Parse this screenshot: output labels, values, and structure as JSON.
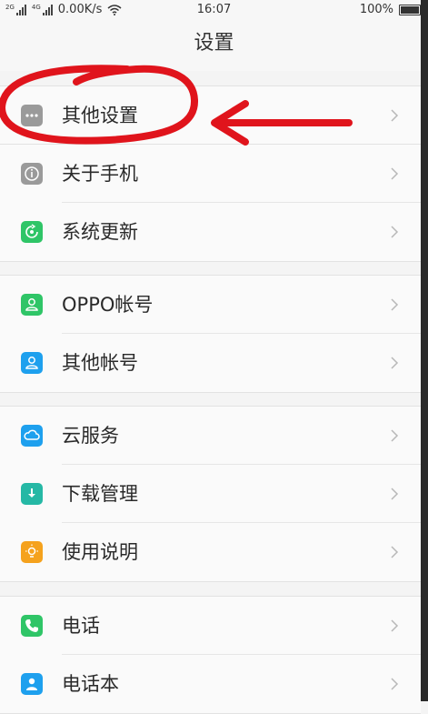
{
  "status_bar": {
    "sim1_tag": "2G",
    "sim2_tag": "4G",
    "network_speed": "0.00K/s",
    "time": "16:07",
    "battery": "100%"
  },
  "header": {
    "title": "设置"
  },
  "groups": [
    [
      {
        "label": "其他设置",
        "icon": "more-dots-icon",
        "color": "#9a9a9a"
      }
    ],
    [
      {
        "label": "关于手机",
        "icon": "info-icon",
        "color": "#9a9a9a"
      },
      {
        "label": "系统更新",
        "icon": "update-icon",
        "color": "#2fc567"
      }
    ],
    [
      {
        "label": "OPPO帐号",
        "icon": "person-icon",
        "color": "#2fc567"
      },
      {
        "label": "其他帐号",
        "icon": "person-icon",
        "color": "#1ea0ee"
      }
    ],
    [
      {
        "label": "云服务",
        "icon": "cloud-icon",
        "color": "#1ea0ee"
      },
      {
        "label": "下载管理",
        "icon": "download-icon",
        "color": "#25b8a5"
      },
      {
        "label": "使用说明",
        "icon": "bulb-icon",
        "color": "#f5a21d"
      }
    ],
    [
      {
        "label": "电话",
        "icon": "phone-icon",
        "color": "#2fc567"
      },
      {
        "label": "电话本",
        "icon": "contacts-icon",
        "color": "#1ea0ee"
      }
    ]
  ],
  "annotation_color": "#e0141c"
}
